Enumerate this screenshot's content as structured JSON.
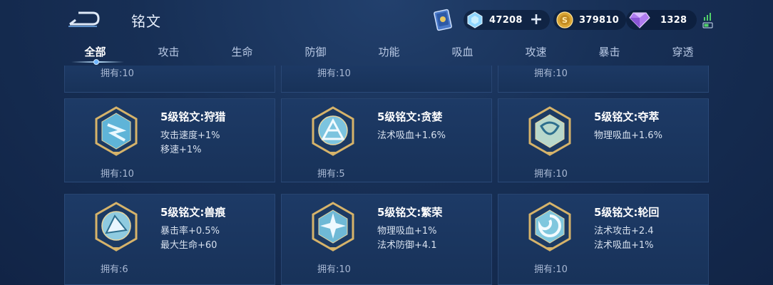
{
  "header": {
    "title": "铭文",
    "resources": [
      {
        "name": "crystal",
        "value": "47208"
      },
      {
        "name": "gold",
        "value": "379810"
      },
      {
        "name": "gem",
        "value": "1328"
      }
    ]
  },
  "tabs": [
    "全部",
    "攻击",
    "生命",
    "防御",
    "功能",
    "吸血",
    "攻速",
    "暴击",
    "穿透"
  ],
  "partial_row": [
    "拥有:10",
    "拥有:10",
    "拥有:10"
  ],
  "cards": [
    {
      "name": "5级铭文:狩猎",
      "attrs": [
        "攻击速度+1%",
        "移速+1%"
      ],
      "owned": "拥有:10",
      "icon": "hunt-emblem-icon"
    },
    {
      "name": "5级铭文:贪婪",
      "attrs": [
        "法术吸血+1.6%"
      ],
      "owned": "拥有:5",
      "icon": "greed-emblem-icon"
    },
    {
      "name": "5级铭文:夺萃",
      "attrs": [
        "物理吸血+1.6%"
      ],
      "owned": "拥有:10",
      "icon": "plunder-emblem-icon"
    },
    {
      "name": "5级铭文:兽痕",
      "attrs": [
        "暴击率+0.5%",
        "最大生命+60"
      ],
      "owned": "拥有:6",
      "icon": "beast-mark-emblem-icon"
    },
    {
      "name": "5级铭文:繁荣",
      "attrs": [
        "物理吸血+1%",
        "法术防御+4.1"
      ],
      "owned": "拥有:10",
      "icon": "prosperity-emblem-icon"
    },
    {
      "name": "5级铭文:轮回",
      "attrs": [
        "法术攻击+2.4",
        "法术吸血+1%"
      ],
      "owned": "拥有:10",
      "icon": "reincarnation-emblem-icon"
    }
  ]
}
